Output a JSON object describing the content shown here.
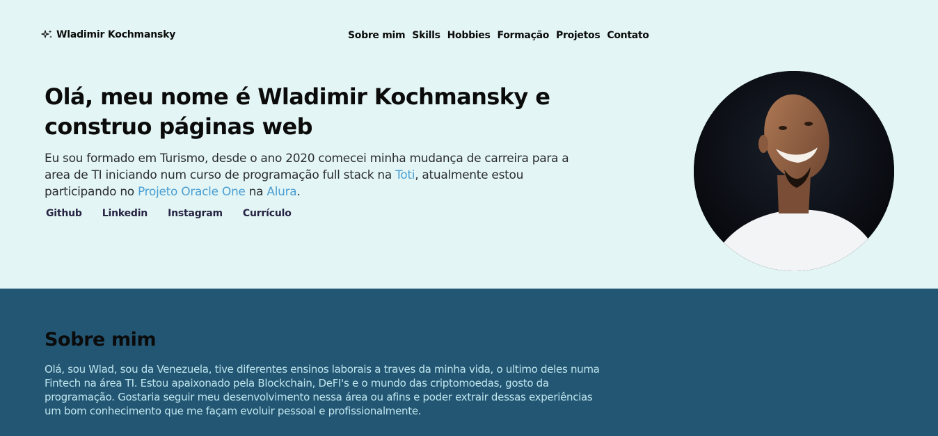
{
  "header": {
    "brand_name": "Wladimir Kochmansky",
    "brand_icon": "sparkles-icon",
    "nav": [
      "Sobre mim",
      "Skills",
      "Hobbies",
      "Formação",
      "Projetos",
      "Contato"
    ]
  },
  "hero": {
    "headline": "Olá, meu nome é Wladimir Kochmansky e construo páginas web",
    "intro": {
      "part1": "Eu sou formado em Turismo, desde o ano 2020 comecei minha mudança de carreira para a area de TI iniciando num curso de programação full stack na ",
      "link1": "Toti",
      "part2": ", atualmente estou participando no ",
      "link2": "Projeto Oracle One",
      "part3": " na ",
      "link3": "Alura",
      "part4": "."
    },
    "social": [
      "Github",
      "Linkedin",
      "Instagram",
      "Currículo"
    ],
    "link_color": "#4b9ed3"
  },
  "about": {
    "title": "Sobre mim",
    "text": "Olá, sou Wlad, sou da Venezuela, tive diferentes ensinos laborais a traves da minha vida, o ultimo deles numa Fintech na área TI. Estou apaixonado pela Blockchain, DeFI's e o mundo das criptomoedas, gosto da programação. Gostaria seguir meu desenvolvimento nessa área ou afins e poder extrair dessas experiências um bom conhecimento que me façam evoluir pessoal e profissionalmente.",
    "background": "#235673"
  },
  "colors": {
    "page_bg": "#e3f6f5",
    "text": "#0b0b0b"
  }
}
